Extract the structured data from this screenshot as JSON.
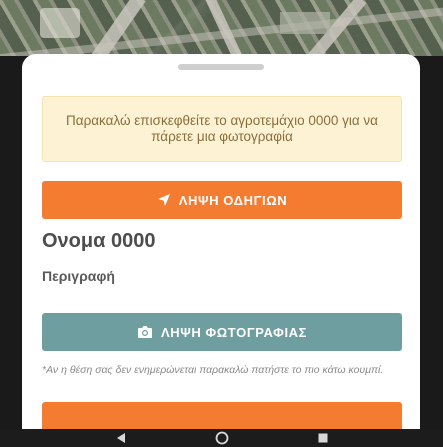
{
  "notice": {
    "text": "Παρακαλώ επισκεφθείτε το αγροτεμάχιο 0000 για να πάρετε μια φωτογραφία"
  },
  "directions_button": {
    "label": "ΛΗΨΗ ΟΔΗΓΙΩΝ",
    "icon": "navigation-arrow-icon"
  },
  "plot": {
    "name": "Ονομα  0000",
    "description_label": "Περιγραφή"
  },
  "photo_button": {
    "label": "ΛΗΨΗ ΦΩΤΟΓΡΑΦΙΑΣ",
    "icon": "camera-icon"
  },
  "hint": "*Αν η θέση σας δεν ενημερώνεται παρακαλώ πατήστε το πιο κάτω κουμπί.",
  "colors": {
    "accent": "#f47c30",
    "photo_button": "#6f9ea0",
    "notice_bg": "#fdf3d4",
    "notice_text": "#8a6d3b"
  },
  "system_nav": {
    "back_icon": "back-triangle-icon",
    "home_icon": "home-circle-icon",
    "recents_icon": "recents-square-icon"
  }
}
